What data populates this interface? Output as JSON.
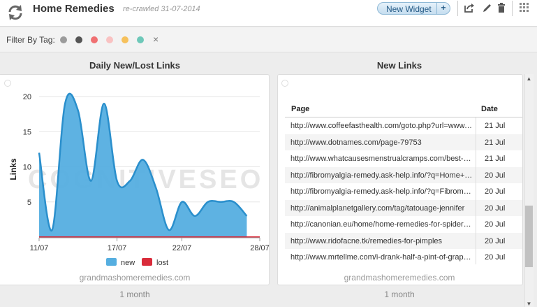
{
  "header": {
    "title": "Home Remedies",
    "crawl_note": "re-crawled 31-07-2014",
    "new_widget_label": "New Widget",
    "new_widget_plus": "+"
  },
  "filter": {
    "label": "Filter By Tag:",
    "tag_colors": [
      "#9b9b9b",
      "#555555",
      "#f07072",
      "#f9c2c2",
      "#f6c15c",
      "#6ec8b9"
    ],
    "clear_label": "×"
  },
  "left_panel": {
    "title": "Daily New/Lost Links",
    "site": "grandmashomeremedies.com",
    "period": "1 month",
    "watermark": "COGNITIVESEO"
  },
  "right_panel": {
    "title": "New Links",
    "site": "grandmashomeremedies.com",
    "period": "1 month",
    "columns": [
      "Page",
      "Date"
    ],
    "rows": [
      {
        "url": "http://www.coffeefasthealth.com/goto.php?url=www.grandmashomeremedies.com",
        "date": "21 Jul"
      },
      {
        "url": "http://www.dotnames.com/page-79753",
        "date": "21 Jul"
      },
      {
        "url": "http://www.whatcausesmenstrualcramps.com/best-home-remedies",
        "date": "21 Jul"
      },
      {
        "url": "http://fibromyalgia-remedy.ask-help.info/?q=Home+Remedies",
        "date": "20 Jul"
      },
      {
        "url": "http://fibromyalgia-remedy.ask-help.info/?q=Fibromyalgia",
        "date": "20 Jul"
      },
      {
        "url": "http://animalplanetgallery.com/tag/tatouage-jennifer",
        "date": "20 Jul"
      },
      {
        "url": "http://canonian.eu/home/home-remedies-for-spider-veins",
        "date": "20 Jul"
      },
      {
        "url": "http://www.ridofacne.tk/remedies-for-pimples",
        "date": "20 Jul"
      },
      {
        "url": "http://www.mrtellme.com/i-drank-half-a-pint-of-grape-juice",
        "date": "20 Jul"
      }
    ]
  },
  "chart_data": {
    "type": "area",
    "title": "Daily New/Lost Links",
    "xlabel": "",
    "ylabel": "Links",
    "x": [
      "11/07",
      "12/07",
      "13/07",
      "14/07",
      "15/07",
      "16/07",
      "17/07",
      "18/07",
      "19/07",
      "20/07",
      "21/07",
      "22/07",
      "23/07",
      "24/07",
      "25/07",
      "26/07",
      "27/07",
      "28/07"
    ],
    "x_tick_labels": [
      "11/07",
      "17/07",
      "22/07",
      "28/07"
    ],
    "x_tick_index": [
      0,
      6,
      11,
      17
    ],
    "yticks": [
      5,
      10,
      15,
      20
    ],
    "ylim": [
      0,
      21
    ],
    "grid": true,
    "legend": "bottom",
    "series": [
      {
        "name": "new",
        "color": "#55aee0",
        "values": [
          12,
          1,
          19,
          18,
          8,
          19,
          8,
          8,
          11,
          7,
          1,
          5,
          3,
          5,
          5,
          5,
          3
        ]
      },
      {
        "name": "lost",
        "color": "#d92b3a",
        "values": [
          0,
          0,
          0,
          0,
          0,
          0,
          0,
          0,
          0,
          0,
          0,
          0,
          0,
          0,
          0,
          0,
          0
        ]
      }
    ]
  }
}
